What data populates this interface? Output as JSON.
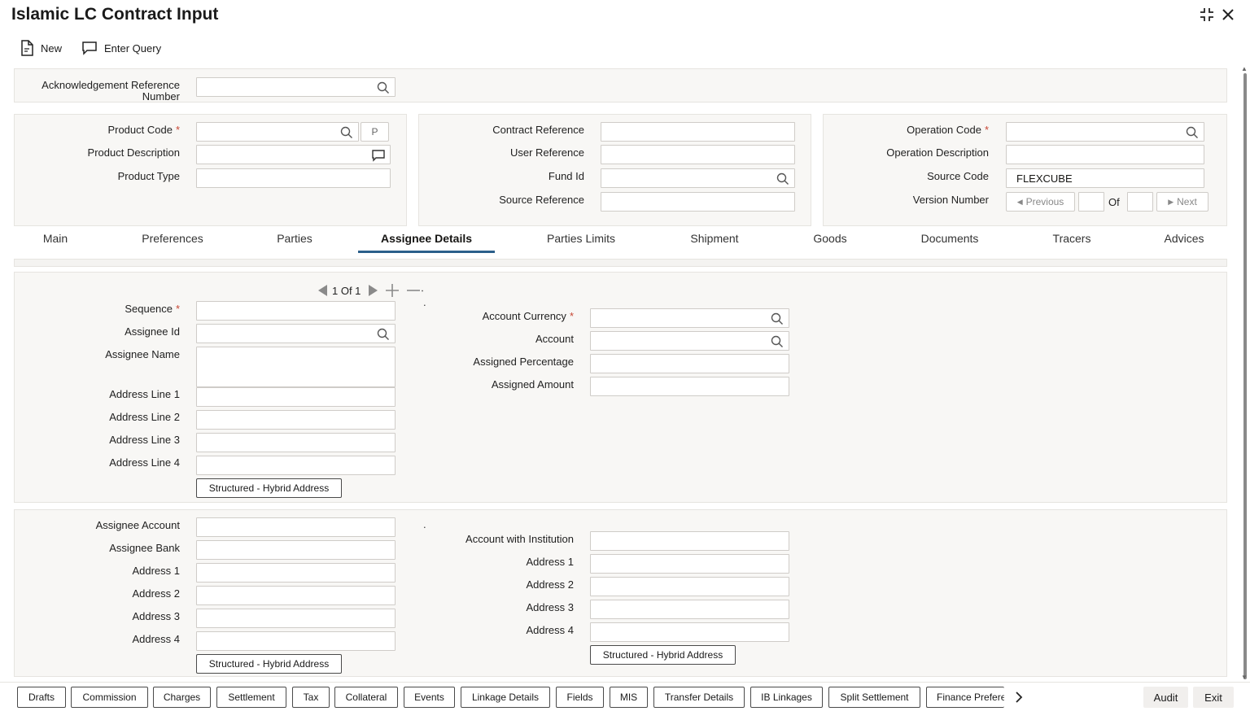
{
  "window": {
    "title": "Islamic LC Contract Input"
  },
  "toolbar": {
    "new_label": "New",
    "enter_query_label": "Enter Query"
  },
  "ack": {
    "label_line1": "Acknowledgement Reference",
    "label_line2": "Number"
  },
  "product": {
    "code_label": "Product Code",
    "p_button": "P",
    "description_label": "Product Description",
    "type_label": "Product Type"
  },
  "contract": {
    "reference_label": "Contract Reference",
    "user_reference_label": "User Reference",
    "fund_id_label": "Fund Id",
    "source_reference_label": "Source Reference"
  },
  "operation": {
    "code_label": "Operation Code",
    "description_label": "Operation Description",
    "source_code_label": "Source Code",
    "source_code_value": "FLEXCUBE",
    "version_label": "Version Number",
    "previous_label": "Previous",
    "of_label": "Of",
    "next_label": "Next"
  },
  "tabs": [
    "Main",
    "Preferences",
    "Parties",
    "Assignee Details",
    "Parties Limits",
    "Shipment",
    "Goods",
    "Documents",
    "Tracers",
    "Advices"
  ],
  "pager": {
    "text": "1 Of 1"
  },
  "assignee": {
    "sequence_label": "Sequence",
    "id_label": "Assignee Id",
    "name_label": "Assignee Name",
    "address1_label": "Address Line 1",
    "address2_label": "Address Line 2",
    "address3_label": "Address Line 3",
    "address4_label": "Address Line 4",
    "hybrid_button": "Structured - Hybrid Address",
    "account_currency_label": "Account Currency",
    "account_label": "Account",
    "percentage_label": "Assigned Percentage",
    "amount_label": "Assigned Amount"
  },
  "bank": {
    "account_label": "Assignee Account",
    "bank_label": "Assignee Bank",
    "address1_label": "Address 1",
    "address2_label": "Address 2",
    "address3_label": "Address 3",
    "address4_label": "Address 4",
    "hybrid_button": "Structured - Hybrid Address",
    "institution_label": "Account with Institution",
    "inst_address1_label": "Address 1",
    "inst_address2_label": "Address 2",
    "inst_address3_label": "Address 3",
    "inst_address4_label": "Address 4",
    "inst_hybrid_button": "Structured - Hybrid Address"
  },
  "footer": {
    "buttons": [
      "Drafts",
      "Commission",
      "Charges",
      "Settlement",
      "Tax",
      "Collateral",
      "Events",
      "Linkage Details",
      "Fields",
      "MIS",
      "Transfer Details",
      "IB Linkages",
      "Split Settlement",
      "Finance Prefere"
    ],
    "audit_label": "Audit",
    "exit_label": "Exit"
  }
}
